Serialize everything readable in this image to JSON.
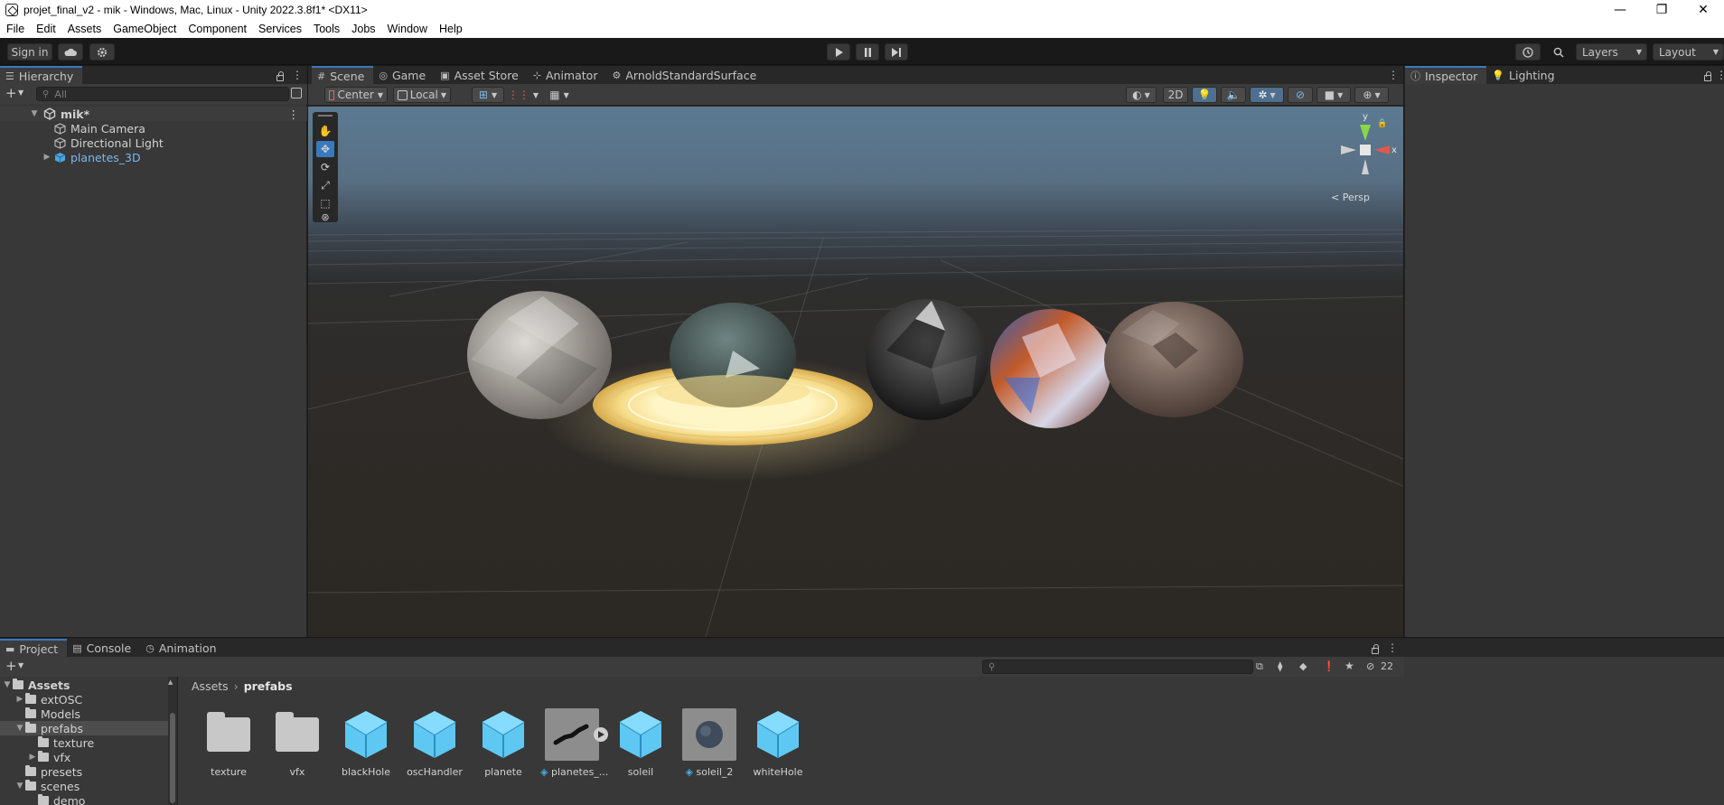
{
  "window": {
    "title": "projet_final_v2 - mik - Windows, Mac, Linux - Unity 2022.3.8f1* <DX11>",
    "controls": [
      "—",
      "❐",
      "✕"
    ]
  },
  "menu": [
    "File",
    "Edit",
    "Assets",
    "GameObject",
    "Component",
    "Services",
    "Tools",
    "Jobs",
    "Window",
    "Help"
  ],
  "toolbar": {
    "sign_in": "Sign in",
    "layers": "Layers",
    "layout": "Layout"
  },
  "hierarchy": {
    "tab": "Hierarchy",
    "search_placeholder": "All",
    "scene": "mik*",
    "items": [
      "Main Camera",
      "Directional Light",
      "planetes_3D"
    ]
  },
  "scene_tabs": [
    "Scene",
    "Game",
    "Asset Store",
    "Animator",
    "ArnoldStandardSurface"
  ],
  "scene_toolbar": {
    "pivot": "Center",
    "space": "Local",
    "mode_2d": "2D"
  },
  "gizmo": {
    "y": "y",
    "x": "x",
    "projection": "< Persp"
  },
  "inspector_tabs": [
    "Inspector",
    "Lighting"
  ],
  "project": {
    "tabs": [
      "Project",
      "Console",
      "Animation"
    ],
    "hidden_count": "22",
    "tree": [
      {
        "label": "Assets",
        "level": 0,
        "arrow": "▼",
        "bold": true
      },
      {
        "label": "extOSC",
        "level": 1,
        "arrow": "▶"
      },
      {
        "label": "Models",
        "level": 1,
        "arrow": ""
      },
      {
        "label": "prefabs",
        "level": 1,
        "arrow": "▼",
        "selected": true
      },
      {
        "label": "texture",
        "level": 2,
        "arrow": ""
      },
      {
        "label": "vfx",
        "level": 2,
        "arrow": "▶"
      },
      {
        "label": "presets",
        "level": 1,
        "arrow": ""
      },
      {
        "label": "scenes",
        "level": 1,
        "arrow": "▼"
      },
      {
        "label": "demo",
        "level": 2,
        "arrow": ""
      }
    ],
    "breadcrumb": [
      "Assets",
      "prefabs"
    ],
    "assets": [
      {
        "label": "texture",
        "kind": "folder"
      },
      {
        "label": "vfx",
        "kind": "folder"
      },
      {
        "label": "blackHole",
        "kind": "prefab"
      },
      {
        "label": "oscHandler",
        "kind": "prefab"
      },
      {
        "label": "planete",
        "kind": "prefab"
      },
      {
        "label": "planetes_...",
        "kind": "model"
      },
      {
        "label": "soleil",
        "kind": "prefab"
      },
      {
        "label": "soleil_2",
        "kind": "variant"
      },
      {
        "label": "whiteHole",
        "kind": "prefab"
      }
    ]
  },
  "colors": {
    "accent": "#3a79bb",
    "panel": "#383838",
    "prefab_blue": "#4fc3f7"
  }
}
